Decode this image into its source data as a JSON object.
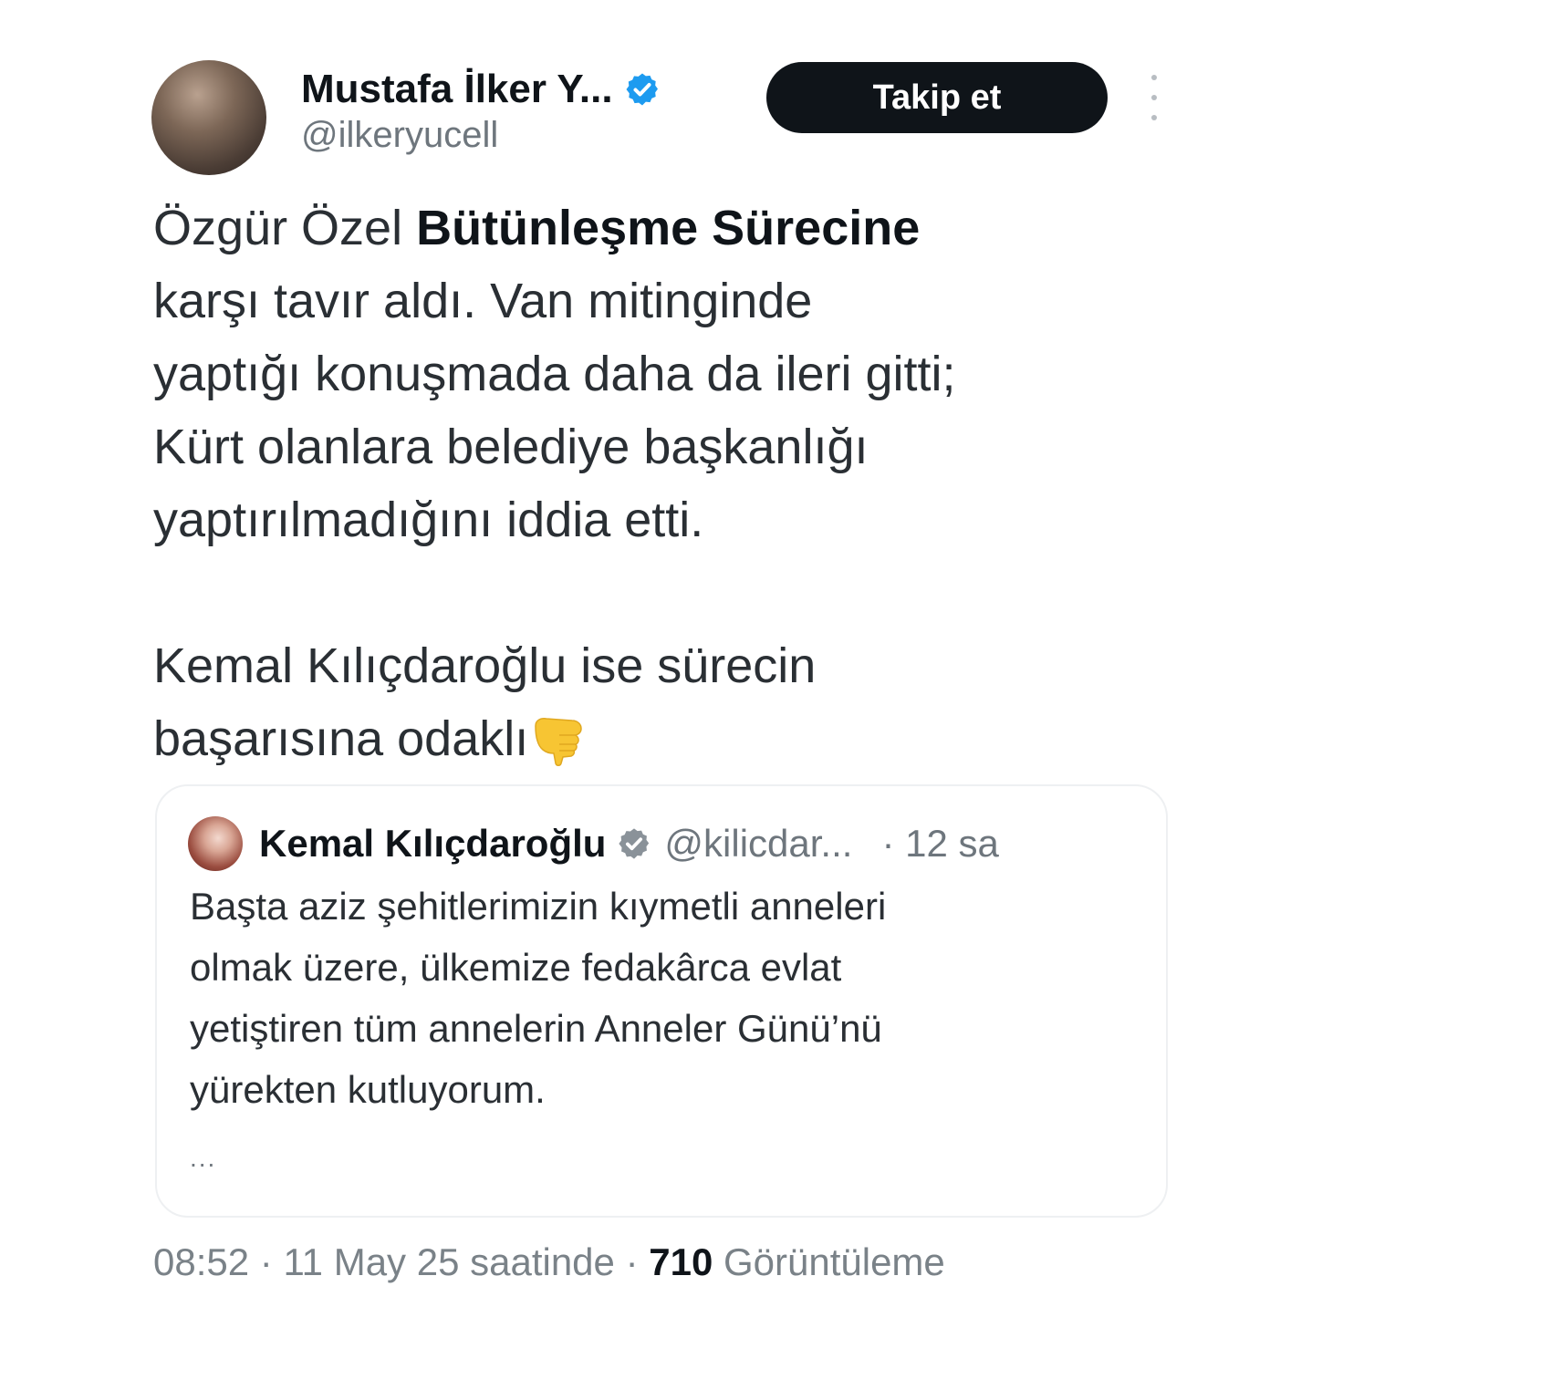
{
  "tweet": {
    "author": {
      "display_name": "Mustafa İlker Y...",
      "handle": "@ilkeryucell",
      "verified": true
    },
    "follow_label": "Takip et",
    "text": {
      "line1_normal": "Özgür Özel ",
      "line1_bold": "Bütünleşme Sürecine",
      "line2": "karşı tavır aldı. Van mitinginde",
      "line3": "yaptığı konuşmada daha da ileri gitti;",
      "line4": "Kürt olanlara belediye başkanlığı",
      "line5": "yaptırılmadığını iddia etti.",
      "line6": "Kemal Kılıçdaroğlu ise sürecin",
      "line7": "başarısına odaklı",
      "emoji": "backhand-index-pointing-down"
    },
    "quoted": {
      "display_name": "Kemal Kılıçdaroğlu",
      "handle": "@kilicdar...",
      "time": "· 12 sa",
      "verified": true,
      "lines": [
        "Başta aziz şehitlerimizin kıymetli anneleri",
        "olmak üzere, ülkemize fedakârca evlat",
        "yetiştiren tüm annelerin Anneler Günü’nü",
        "yürekten kutluyorum."
      ],
      "more": "..."
    },
    "meta": {
      "time": "08:52",
      "sep1": " · ",
      "date": "11 May 25 saatinde",
      "sep2": " · ",
      "views_count": "710",
      "views_label": " Görüntüleme"
    }
  },
  "colors": {
    "verified_blue": "#1d9bf0",
    "quote_verified_gray": "#8a9299",
    "button_black": "#0f1419",
    "text_gray": "#6e767d",
    "emoji_yellow": "#f7c533"
  }
}
